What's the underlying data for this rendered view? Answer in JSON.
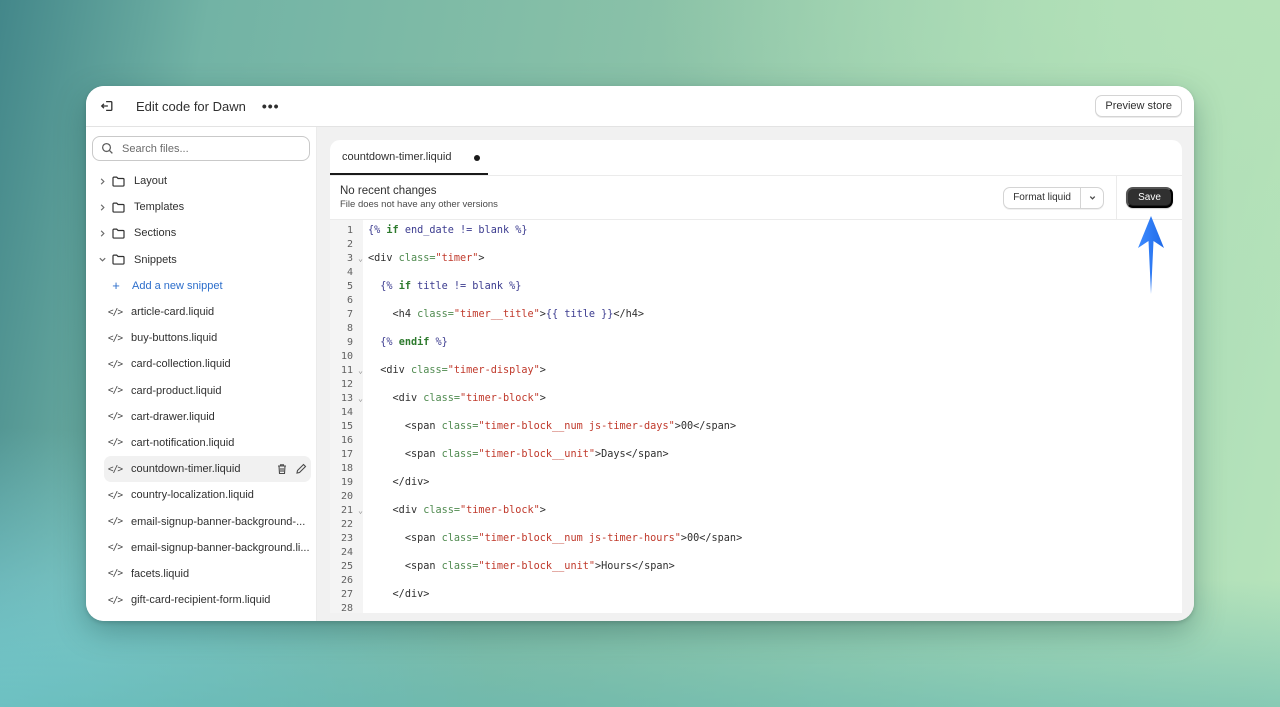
{
  "topbar": {
    "title": "Edit code for Dawn",
    "more_label": "•••",
    "preview_button": "Preview store"
  },
  "sidebar": {
    "search_placeholder": "Search files...",
    "folders": [
      {
        "label": "Layout",
        "expanded": false
      },
      {
        "label": "Templates",
        "expanded": false
      },
      {
        "label": "Sections",
        "expanded": false
      },
      {
        "label": "Snippets",
        "expanded": true
      }
    ],
    "add_snippet_label": "Add a new snippet",
    "files": [
      "article-card.liquid",
      "buy-buttons.liquid",
      "card-collection.liquid",
      "card-product.liquid",
      "cart-drawer.liquid",
      "cart-notification.liquid",
      "countdown-timer.liquid",
      "country-localization.liquid",
      "email-signup-banner-background-...",
      "email-signup-banner-background.li...",
      "facets.liquid",
      "gift-card-recipient-form.liquid"
    ],
    "active_file": "countdown-timer.liquid"
  },
  "editor": {
    "tab_label": "countdown-timer.liquid",
    "status_title": "No recent changes",
    "status_subtitle": "File does not have any other versions",
    "format_button": "Format liquid",
    "save_button": "Save",
    "fold_lines": [
      3,
      11,
      13,
      21
    ],
    "lines": [
      [
        [
          "liq",
          "{% "
        ],
        [
          "kw",
          "if"
        ],
        [
          "var",
          " end_date != blank "
        ],
        [
          "liq",
          "%}"
        ]
      ],
      [],
      [
        [
          "tag",
          "<div "
        ],
        [
          "attr",
          "class="
        ],
        [
          "str",
          "\"timer\""
        ],
        [
          "tag",
          ">"
        ]
      ],
      [],
      [
        [
          "text",
          "  "
        ],
        [
          "liq",
          "{% "
        ],
        [
          "kw",
          "if"
        ],
        [
          "var",
          " title != blank "
        ],
        [
          "liq",
          "%}"
        ]
      ],
      [],
      [
        [
          "text",
          "    "
        ],
        [
          "tag",
          "<h4 "
        ],
        [
          "attr",
          "class="
        ],
        [
          "str",
          "\"timer__title\""
        ],
        [
          "tag",
          ">"
        ],
        [
          "var",
          "{{ title }}"
        ],
        [
          "tag",
          "</h4>"
        ]
      ],
      [],
      [
        [
          "text",
          "  "
        ],
        [
          "liq",
          "{% "
        ],
        [
          "kw",
          "endif"
        ],
        [
          "liq",
          " %}"
        ]
      ],
      [],
      [
        [
          "text",
          "  "
        ],
        [
          "tag",
          "<div "
        ],
        [
          "attr",
          "class="
        ],
        [
          "str",
          "\"timer-display\""
        ],
        [
          "tag",
          ">"
        ]
      ],
      [],
      [
        [
          "text",
          "    "
        ],
        [
          "tag",
          "<div "
        ],
        [
          "attr",
          "class="
        ],
        [
          "str",
          "\"timer-block\""
        ],
        [
          "tag",
          ">"
        ]
      ],
      [],
      [
        [
          "text",
          "      "
        ],
        [
          "tag",
          "<span "
        ],
        [
          "attr",
          "class="
        ],
        [
          "str",
          "\"timer-block__num js-timer-days\""
        ],
        [
          "tag",
          ">"
        ],
        [
          "text",
          "00"
        ],
        [
          "tag",
          "</span>"
        ]
      ],
      [],
      [
        [
          "text",
          "      "
        ],
        [
          "tag",
          "<span "
        ],
        [
          "attr",
          "class="
        ],
        [
          "str",
          "\"timer-block__unit\""
        ],
        [
          "tag",
          ">"
        ],
        [
          "text",
          "Days"
        ],
        [
          "tag",
          "</span>"
        ]
      ],
      [],
      [
        [
          "text",
          "    "
        ],
        [
          "tag",
          "</div>"
        ]
      ],
      [],
      [
        [
          "text",
          "    "
        ],
        [
          "tag",
          "<div "
        ],
        [
          "attr",
          "class="
        ],
        [
          "str",
          "\"timer-block\""
        ],
        [
          "tag",
          ">"
        ]
      ],
      [],
      [
        [
          "text",
          "      "
        ],
        [
          "tag",
          "<span "
        ],
        [
          "attr",
          "class="
        ],
        [
          "str",
          "\"timer-block__num js-timer-hours\""
        ],
        [
          "tag",
          ">"
        ],
        [
          "text",
          "00"
        ],
        [
          "tag",
          "</span>"
        ]
      ],
      [],
      [
        [
          "text",
          "      "
        ],
        [
          "tag",
          "<span "
        ],
        [
          "attr",
          "class="
        ],
        [
          "str",
          "\"timer-block__unit\""
        ],
        [
          "tag",
          ">"
        ],
        [
          "text",
          "Hours"
        ],
        [
          "tag",
          "</span>"
        ]
      ],
      [],
      [
        [
          "text",
          "    "
        ],
        [
          "tag",
          "</div>"
        ]
      ],
      []
    ]
  },
  "colors": {
    "accent_link": "#2c6ecb",
    "save_button_bg": "#303030",
    "arrow_annotation": "#2f7cf6"
  }
}
